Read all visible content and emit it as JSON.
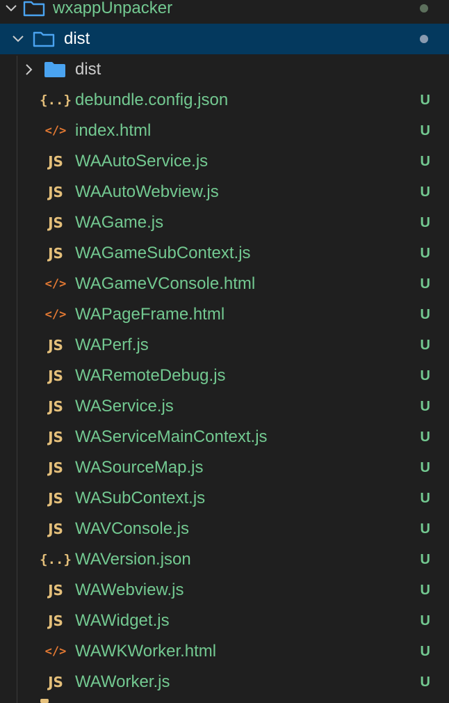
{
  "explorer": {
    "root": {
      "label": "wxappUnpacker",
      "dot_color": "#5c6f5c"
    },
    "dist": {
      "label": "dist",
      "dot_color": "#8a9bb0"
    },
    "subfolder": {
      "label": "dist"
    },
    "status_untracked": "U",
    "icons": {
      "js": "JS",
      "json": "{..}",
      "html": "</>"
    },
    "files": [
      {
        "name": "debundle.config.json",
        "type": "json",
        "status": "U"
      },
      {
        "name": "index.html",
        "type": "html",
        "status": "U"
      },
      {
        "name": "WAAutoService.js",
        "type": "js",
        "status": "U"
      },
      {
        "name": "WAAutoWebview.js",
        "type": "js",
        "status": "U"
      },
      {
        "name": "WAGame.js",
        "type": "js",
        "status": "U"
      },
      {
        "name": "WAGameSubContext.js",
        "type": "js",
        "status": "U"
      },
      {
        "name": "WAGameVConsole.html",
        "type": "html",
        "status": "U"
      },
      {
        "name": "WAPageFrame.html",
        "type": "html",
        "status": "U"
      },
      {
        "name": "WAPerf.js",
        "type": "js",
        "status": "U"
      },
      {
        "name": "WARemoteDebug.js",
        "type": "js",
        "status": "U"
      },
      {
        "name": "WAService.js",
        "type": "js",
        "status": "U"
      },
      {
        "name": "WAServiceMainContext.js",
        "type": "js",
        "status": "U"
      },
      {
        "name": "WASourceMap.js",
        "type": "js",
        "status": "U"
      },
      {
        "name": "WASubContext.js",
        "type": "js",
        "status": "U"
      },
      {
        "name": "WAVConsole.js",
        "type": "js",
        "status": "U"
      },
      {
        "name": "WAVersion.json",
        "type": "json",
        "status": "U"
      },
      {
        "name": "WAWebview.js",
        "type": "js",
        "status": "U"
      },
      {
        "name": "WAWidget.js",
        "type": "js",
        "status": "U"
      },
      {
        "name": "WAWKWorker.html",
        "type": "html",
        "status": "U"
      },
      {
        "name": "WAWorker.js",
        "type": "js",
        "status": "U"
      }
    ]
  }
}
